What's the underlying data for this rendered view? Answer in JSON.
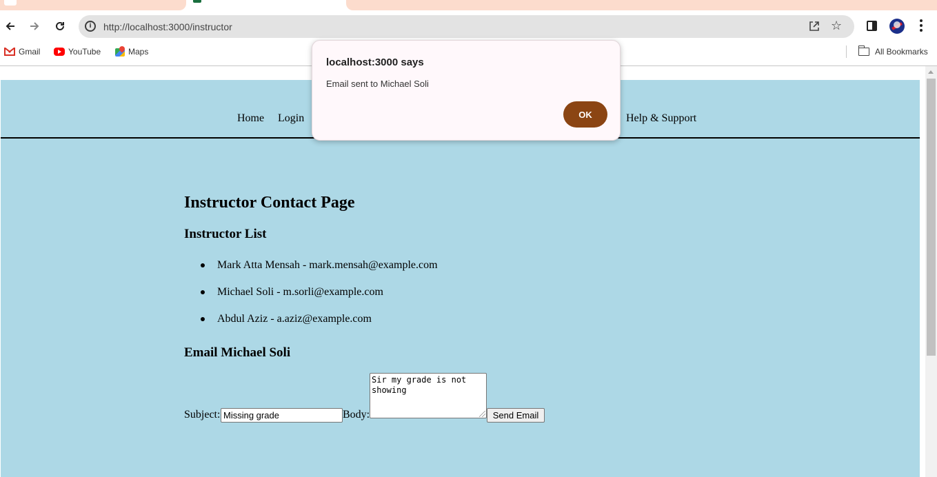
{
  "browser": {
    "url": "http://localhost:3000/instructor",
    "bookmarks": [
      {
        "label": "Gmail",
        "icon": "gmail-icon"
      },
      {
        "label": "YouTube",
        "icon": "youtube-icon"
      },
      {
        "label": "Maps",
        "icon": "maps-icon"
      }
    ],
    "all_bookmarks_label": "All Bookmarks",
    "tab_color": "#fcdccd"
  },
  "site": {
    "background_color": "#add8e6",
    "nav": {
      "home": "Home",
      "login": "Login",
      "help": "Help & Support"
    },
    "page_title": "Instructor Contact Page",
    "list_heading": "Instructor List",
    "instructors": [
      "Mark Atta Mensah - mark.mensah@example.com",
      "Michael Soli - m.sorli@example.com",
      "Abdul Aziz - a.aziz@example.com"
    ],
    "email_heading": "Email Michael Soli",
    "form": {
      "subject_label": "Subject:",
      "subject_value": "Missing grade",
      "body_label": "Body:",
      "body_value": "Sir my grade is not showing",
      "send_label": "Send Email"
    }
  },
  "dialog": {
    "title": "localhost:3000 says",
    "message": "Email sent to Michael Soli",
    "ok_label": "OK",
    "ok_color": "#8b4513"
  }
}
